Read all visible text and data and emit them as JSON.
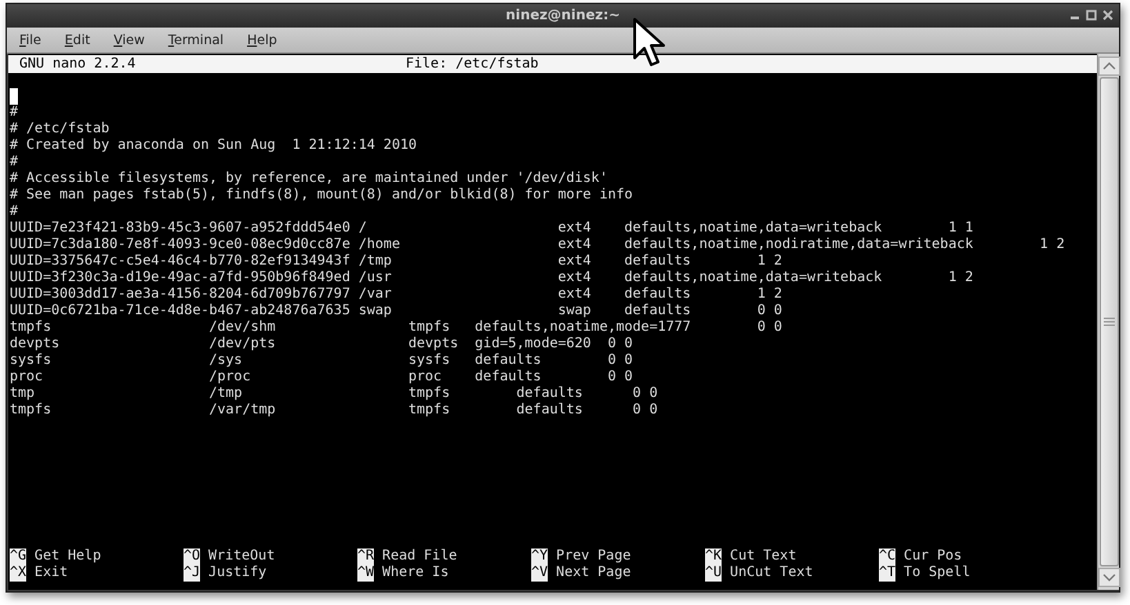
{
  "window": {
    "title": "ninez@ninez:~"
  },
  "menu": [
    {
      "label": "File"
    },
    {
      "label": "Edit"
    },
    {
      "label": "View"
    },
    {
      "label": "Terminal"
    },
    {
      "label": "Help"
    }
  ],
  "nano": {
    "version": "GNU nano 2.2.4",
    "file": "File: /etc/fstab"
  },
  "lines": [
    "#",
    "# /etc/fstab",
    "# Created by anaconda on Sun Aug  1 21:12:14 2010",
    "#",
    "# Accessible filesystems, by reference, are maintained under '/dev/disk'",
    "# See man pages fstab(5), findfs(8), mount(8) and/or blkid(8) for more info",
    "#",
    "UUID=7e23f421-83b9-45c3-9607-a952fddd54e0 /                       ext4    defaults,noatime,data=writeback        1 1",
    "UUID=7c3da180-7e8f-4093-9ce0-08ec9d0cc87e /home                   ext4    defaults,noatime,nodiratime,data=writeback        1 2",
    "UUID=3375647c-c5e4-46c4-b770-82ef9134943f /tmp                    ext4    defaults        1 2",
    "UUID=3f230c3a-d19e-49ac-a7fd-950b96f849ed /usr                    ext4    defaults,noatime,data=writeback        1 2",
    "UUID=3003dd17-ae3a-4156-8204-6d709b767797 /var                    ext4    defaults        1 2",
    "UUID=0c6721ba-71ce-4d8e-b467-ab24876a7635 swap                    swap    defaults        0 0",
    "tmpfs                   /dev/shm                tmpfs   defaults,noatime,mode=1777        0 0",
    "devpts                  /dev/pts                devpts  gid=5,mode=620  0 0",
    "sysfs                   /sys                    sysfs   defaults        0 0",
    "proc                    /proc                   proc    defaults        0 0",
    "tmp                     /tmp                    tmpfs        defaults      0 0",
    "tmpfs                   /var/tmp                tmpfs        defaults      0 0"
  ],
  "shortcuts": [
    [
      {
        "key": "^G",
        "label": "Get Help"
      },
      {
        "key": "^O",
        "label": "WriteOut"
      },
      {
        "key": "^R",
        "label": "Read File"
      },
      {
        "key": "^Y",
        "label": "Prev Page"
      },
      {
        "key": "^K",
        "label": "Cut Text"
      },
      {
        "key": "^C",
        "label": "Cur Pos"
      }
    ],
    [
      {
        "key": "^X",
        "label": "Exit"
      },
      {
        "key": "^J",
        "label": "Justify"
      },
      {
        "key": "^W",
        "label": "Where Is"
      },
      {
        "key": "^V",
        "label": "Next Page"
      },
      {
        "key": "^U",
        "label": "UnCut Text"
      },
      {
        "key": "^T",
        "label": "To Spell"
      }
    ]
  ]
}
